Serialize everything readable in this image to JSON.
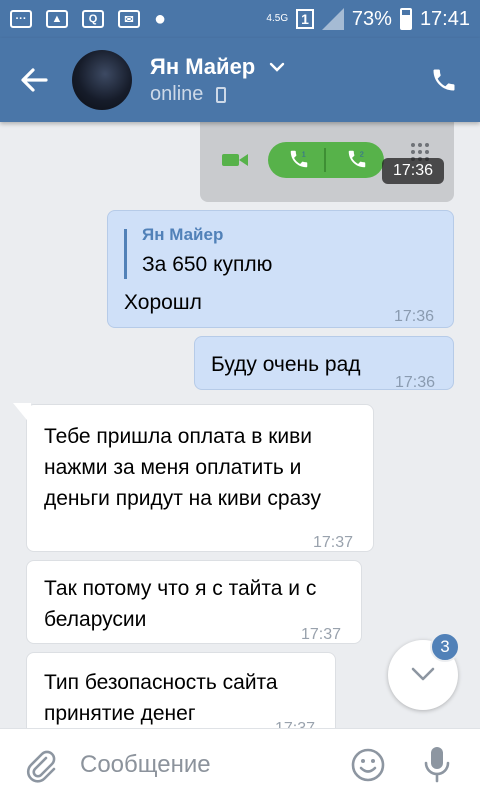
{
  "status_bar": {
    "network": "4.5G",
    "sim": "1",
    "battery": "73%",
    "time": "17:41"
  },
  "header": {
    "name": "Ян Майер",
    "status": "online"
  },
  "messages": [
    {
      "type": "image",
      "time": "17:36",
      "badges": [
        "1",
        "2"
      ]
    },
    {
      "type": "out",
      "quote_author": "Ян Майер",
      "quote_text": "За 650 куплю",
      "text": "Хорошл",
      "time": "17:36"
    },
    {
      "type": "out",
      "text": "Буду очень рад",
      "time": "17:36"
    },
    {
      "type": "in",
      "text": "Тебе пришла оплата в киви нажми за меня оплатить и деньги придут на киви сразу",
      "time": "17:37"
    },
    {
      "type": "in",
      "text": "Так потому что я с тайта и с беларусии",
      "time": "17:37"
    },
    {
      "type": "in",
      "text": "Тип безопасность сайта принятие денег",
      "time": "17:37"
    }
  ],
  "scroll": {
    "unread_count": "3"
  },
  "composer": {
    "placeholder": "Сообщение"
  },
  "colors": {
    "accent": "#4a76a8",
    "outgoing_bubble": "#cfe0f8",
    "incoming_bubble": "#ffffff",
    "call_green": "#57b24a"
  },
  "icons": [
    "back-arrow-icon",
    "chevron-down-icon",
    "phone-call-icon",
    "video-icon",
    "phone-icon",
    "keypad-icon",
    "chevron-down-icon",
    "paperclip-icon",
    "emoji-icon",
    "microphone-icon"
  ]
}
